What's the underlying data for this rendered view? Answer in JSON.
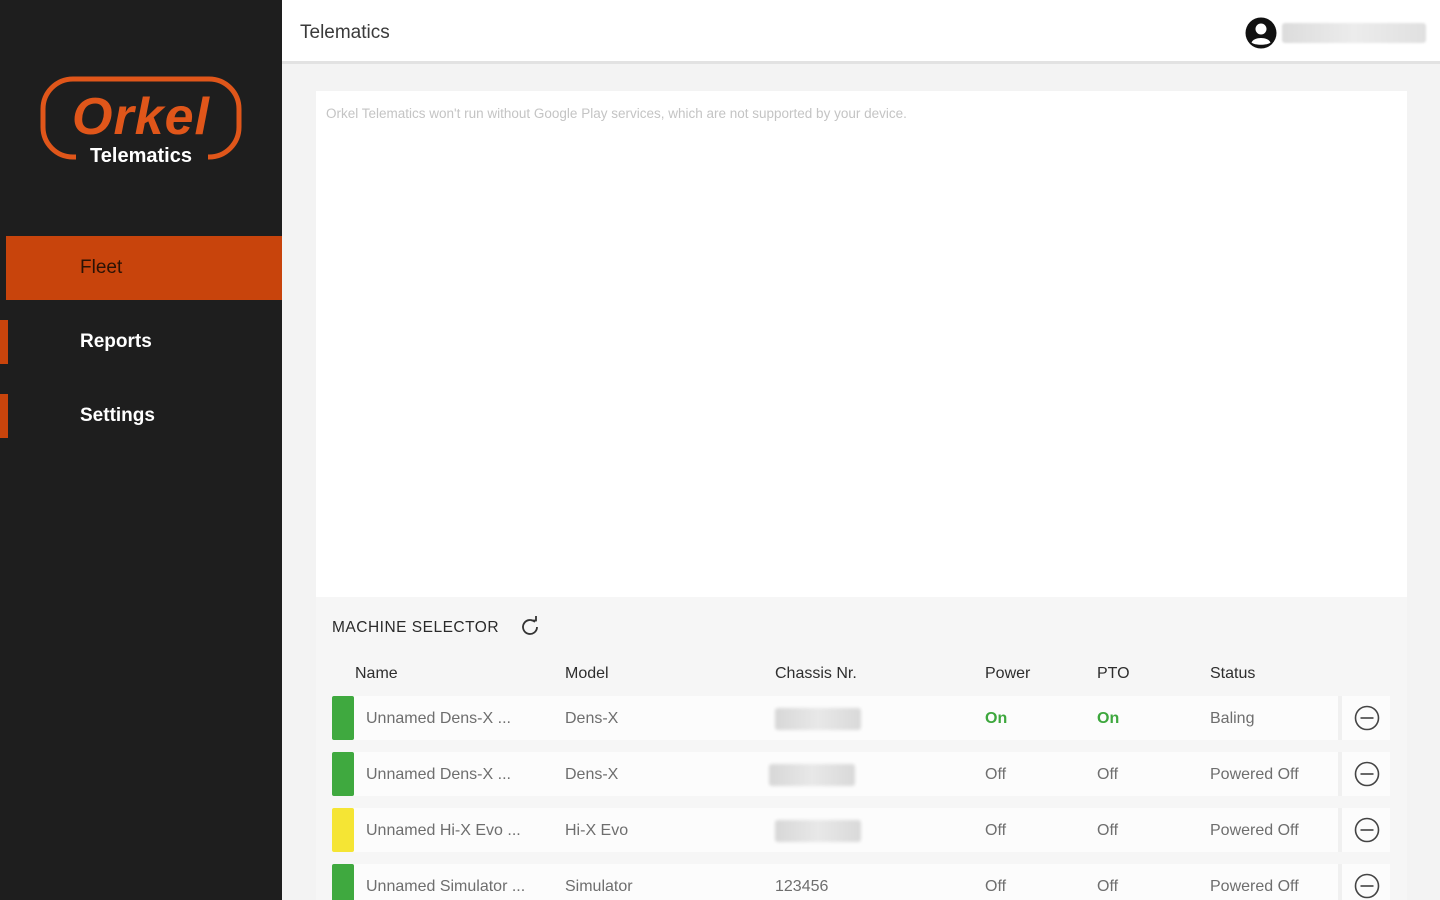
{
  "app": {
    "logo_word": "Orkel",
    "logo_sub": "Telematics",
    "brand_color": "#c8440c"
  },
  "sidebar": {
    "items": [
      {
        "label": "Fleet",
        "active": true
      },
      {
        "label": "Reports",
        "active": false
      },
      {
        "label": "Settings",
        "active": false
      }
    ]
  },
  "header": {
    "title": "Telematics",
    "account_icon": "account-circle-icon"
  },
  "map": {
    "message": "Orkel Telematics won't run without Google Play services, which are not supported by your device."
  },
  "machine_selector": {
    "title": "MACHINE SELECTOR",
    "refresh_icon": "refresh-icon",
    "columns": [
      "Name",
      "Model",
      "Chassis Nr.",
      "Power",
      "PTO",
      "Status"
    ],
    "rows": [
      {
        "indicator_color": "#3fa93f",
        "name": "Unnamed Dens-X ...",
        "model": "Dens-X",
        "chassis": "",
        "power": "On",
        "pto": "On",
        "status": "Baling"
      },
      {
        "indicator_color": "#3fa93f",
        "name": "Unnamed Dens-X ...",
        "model": "Dens-X",
        "chassis": "",
        "power": "Off",
        "pto": "Off",
        "status": "Powered Off"
      },
      {
        "indicator_color": "#f5e534",
        "name": "Unnamed Hi-X Evo ...",
        "model": "Hi-X Evo",
        "chassis": "",
        "power": "Off",
        "pto": "Off",
        "status": "Powered Off"
      },
      {
        "indicator_color": "#3fa93f",
        "name": "Unnamed Simulator ...",
        "model": "Simulator",
        "chassis": "123456",
        "power": "Off",
        "pto": "Off",
        "status": "Powered Off"
      }
    ],
    "status_on_color": "#3da73d"
  }
}
